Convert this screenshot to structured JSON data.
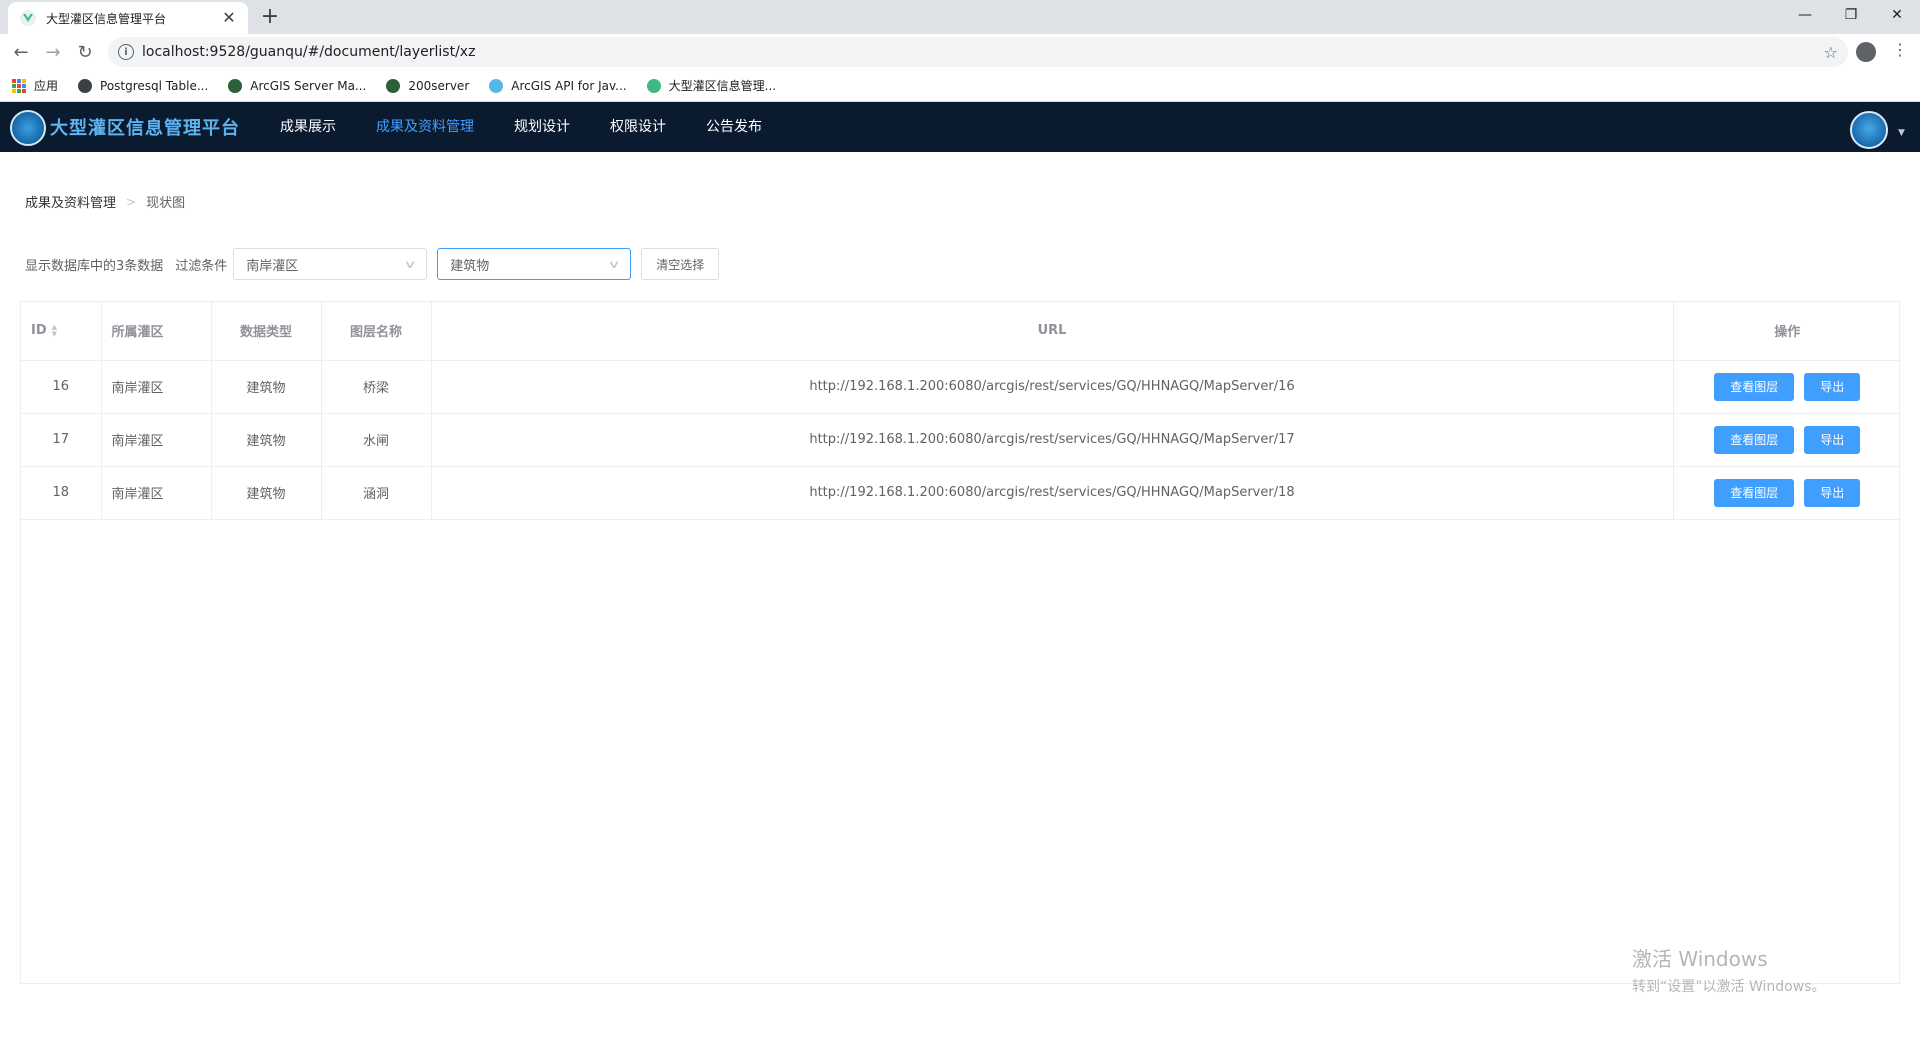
{
  "browser": {
    "tab_title": "大型灌区信息管理平台",
    "url": "localhost:9528/guanqu/#/document/layerlist/xz",
    "bookmarks": [
      {
        "label": "应用"
      },
      {
        "label": "Postgresql Table..."
      },
      {
        "label": "ArcGIS Server Ma..."
      },
      {
        "label": "200server"
      },
      {
        "label": "ArcGIS API for Jav..."
      },
      {
        "label": "大型灌区信息管理..."
      }
    ]
  },
  "header": {
    "brand": "大型灌区信息管理平台",
    "nav": [
      {
        "label": "成果展示",
        "active": false
      },
      {
        "label": "成果及资料管理",
        "active": true
      },
      {
        "label": "规划设计",
        "active": false
      },
      {
        "label": "权限设计",
        "active": false
      },
      {
        "label": "公告发布",
        "active": false
      }
    ],
    "accent": "#409eff",
    "bg": "#0a1a2f"
  },
  "breadcrumb": {
    "parent": "成果及资料管理",
    "current": "现状图"
  },
  "filter": {
    "count_text": "显示数据库中的3条数据",
    "label": "过滤条件",
    "district": "南岸灌区",
    "type": "建筑物",
    "clear": "清空选择"
  },
  "table": {
    "columns": [
      "ID",
      "所属灌区",
      "数据类型",
      "图层名称",
      "URL",
      "操作"
    ],
    "rows": [
      {
        "id": "16",
        "district": "南岸灌区",
        "type": "建筑物",
        "name": "桥梁",
        "url": "http://192.168.1.200:6080/arcgis/rest/services/GQ/HHNAGQ/MapServer/16"
      },
      {
        "id": "17",
        "district": "南岸灌区",
        "type": "建筑物",
        "name": "水闸",
        "url": "http://192.168.1.200:6080/arcgis/rest/services/GQ/HHNAGQ/MapServer/17"
      },
      {
        "id": "18",
        "district": "南岸灌区",
        "type": "建筑物",
        "name": "涵洞",
        "url": "http://192.168.1.200:6080/arcgis/rest/services/GQ/HHNAGQ/MapServer/18"
      }
    ],
    "view_label": "查看图层",
    "export_label": "导出"
  },
  "watermark": {
    "line1": "激活 Windows",
    "line2": "转到“设置”以激活 Windows。"
  }
}
